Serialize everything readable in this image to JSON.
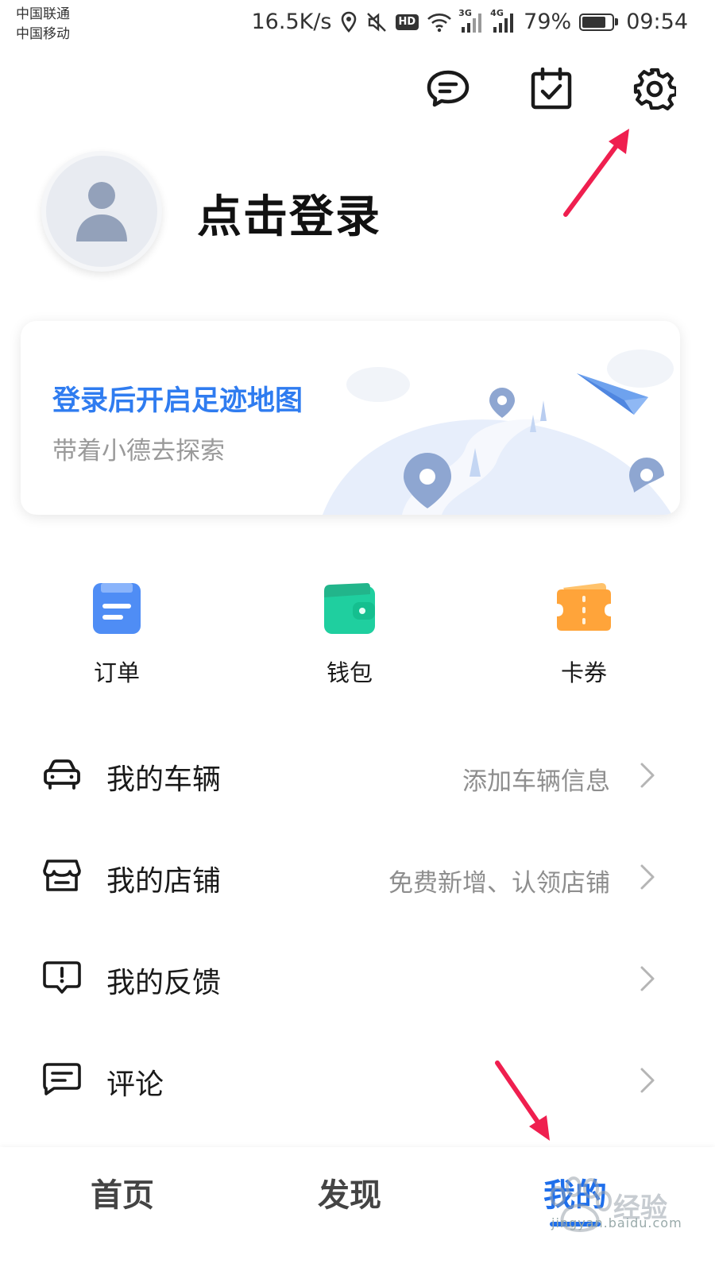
{
  "status_bar": {
    "carrier_1": "中国联通",
    "carrier_2": "中国移动",
    "net_speed": "16.5K/s",
    "hd_badge": "HD",
    "net_3g": "3G",
    "net_4g": "4G",
    "battery_percent": "79%",
    "battery_level": 0.79,
    "time": "09:54"
  },
  "top_actions": {
    "icons": [
      "message-icon",
      "calendar-check-icon",
      "settings-icon"
    ]
  },
  "profile": {
    "login_prompt": "点击登录"
  },
  "footprint_card": {
    "title": "登录后开启足迹地图",
    "subtitle": "带着小德去探索"
  },
  "quick_access": [
    {
      "label": "订单",
      "icon": "order-icon",
      "color": "#4f8df5"
    },
    {
      "label": "钱包",
      "icon": "wallet-icon",
      "color": "#1fcf9f"
    },
    {
      "label": "卡券",
      "icon": "coupon-icon",
      "color": "#ffa43a"
    }
  ],
  "menu": [
    {
      "label": "我的车辆",
      "hint": "添加车辆信息",
      "icon": "car-icon"
    },
    {
      "label": "我的店铺",
      "hint": "免费新增、认领店铺",
      "icon": "store-icon"
    },
    {
      "label": "我的反馈",
      "hint": "",
      "icon": "feedback-icon"
    },
    {
      "label": "评论",
      "hint": "",
      "icon": "comment-icon"
    }
  ],
  "tab_bar": {
    "tabs": [
      "首页",
      "发现",
      "我的"
    ],
    "active": "我的"
  },
  "watermark": {
    "text": "jingyan.baidu.com",
    "logo_text": "经验"
  },
  "colors": {
    "accent": "#1f6feb",
    "card_title": "#2f7cf0",
    "annotation_arrow": "#ef1f4f"
  }
}
